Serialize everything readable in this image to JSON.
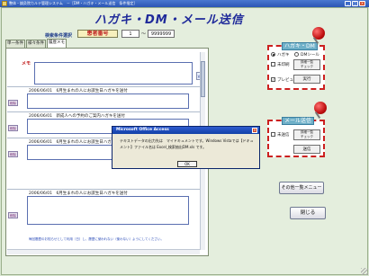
{
  "window": {
    "title": "整体・鍼灸院カルテ管理システム　－［DM・ハガキ・メール送信　条件指定］",
    "minimize": "_",
    "maximize": "□",
    "close": "×"
  },
  "app_title": "ハガキ・DM・メール送信",
  "search": {
    "label": "検索条件選択",
    "field": "患者番号",
    "from": "1",
    "separator": "～",
    "to": "9999999"
  },
  "tabs": [
    {
      "label": "単一条件"
    },
    {
      "label": "様々条件"
    },
    {
      "label": "履歴メモ"
    }
  ],
  "memo": {
    "label": "メモ",
    "add_button": "追加",
    "clear_button": "消去"
  },
  "history_rows": [
    {
      "date": "2006/06/01",
      "text": "6月生まれの人にお誕生日ハガキを送付",
      "delete": "削除"
    },
    {
      "date": "2006/06/01",
      "text": "新成人への予約のご案内ハガキを送付",
      "delete": "削除"
    },
    {
      "date": "2006/06/01",
      "text": "6月生まれの人にお誕生日ハガキを送付",
      "delete": "削除"
    },
    {
      "date": "2006/06/01",
      "text": "6月生まれの人にお誕生日ハガキを送付",
      "delete": "削除"
    }
  ],
  "footer_note": "毎回履歴のお知らせとして利用（日）し、履歴に使われない（使わない）ようにしてください。",
  "postcard_group": {
    "title": "ハガキ・DM",
    "radio_postcard": "ハガキ",
    "radio_dm": "DMシール",
    "check_unprinted": "未印刷",
    "detail_button": "詳細一覧\nチェック",
    "check_preview": "プレビュー",
    "run_button": "実行"
  },
  "mail_group": {
    "title": "メール送信",
    "check_unsent": "未送信",
    "detail_button": "詳細一覧\nチェック",
    "send_button": "送信"
  },
  "other_list_button": "その他一覧メニュー",
  "close_button": "閉じる",
  "dialog": {
    "title": "Microsoft Office Access",
    "message": "テキストデータの出力先は　マイドキュメントです。Windows Vistaでは【ドキュメント】ファイル名は Excel_検索抽出DM.xls です。",
    "ok": "OK"
  },
  "colors": {
    "accent_title": "#1f2a9a",
    "group_border": "#cc1f1f",
    "search_field_bg": "#f7f0bd"
  }
}
